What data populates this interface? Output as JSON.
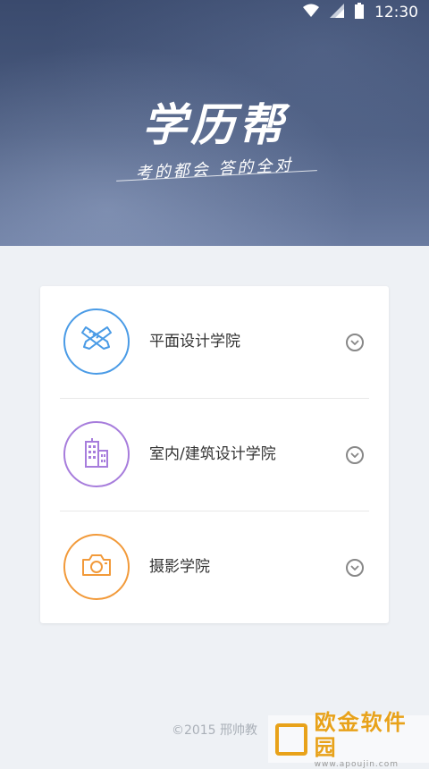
{
  "status_bar": {
    "time": "12:30"
  },
  "hero": {
    "title": "学历帮",
    "slogan": "考的都会 答的全对"
  },
  "colleges": [
    {
      "label": "平面设计学院",
      "icon": "drafting-tools-icon",
      "color": "#4a9be6"
    },
    {
      "label": "室内/建筑设计学院",
      "icon": "building-icon",
      "color": "#a77ddc"
    },
    {
      "label": "摄影学院",
      "icon": "camera-icon",
      "color": "#f29a3a"
    }
  ],
  "footer": {
    "copyright": "©2015 邢帅教"
  },
  "watermark": {
    "name": "欧金软件园",
    "url": "www.apoujin.com"
  }
}
